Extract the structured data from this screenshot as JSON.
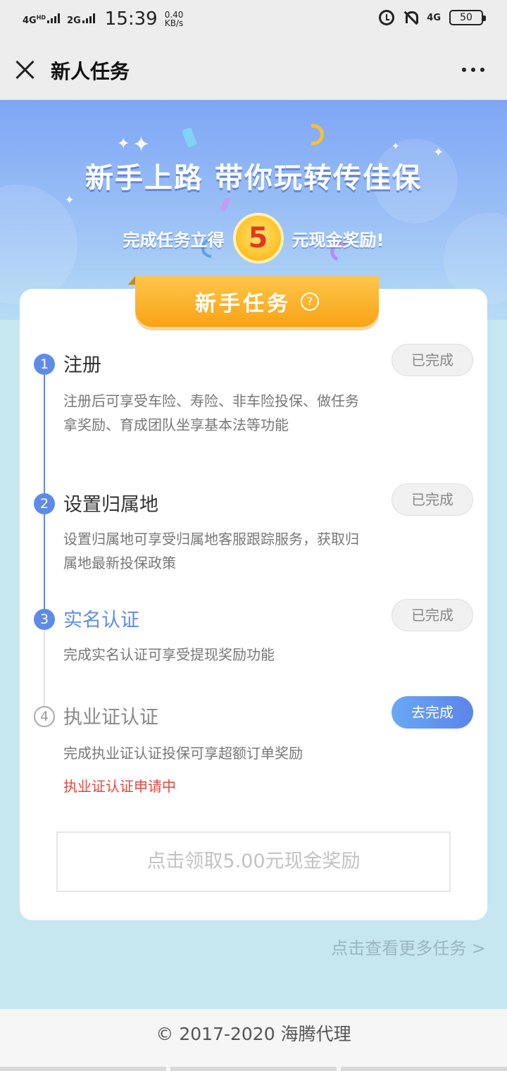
{
  "status_bar": {
    "network1": "4G",
    "network1_sup": "HD",
    "network2": "2G",
    "time": "15:39",
    "speed_value": "0.40",
    "speed_unit": "KB/s",
    "network3": "4G",
    "battery": "50"
  },
  "header": {
    "title": "新人任务"
  },
  "banner": {
    "title": "新手上路  带你玩转传佳保",
    "sub_prefix": "完成任务立得",
    "coin_value": "5",
    "sub_suffix": "元现金奖励!"
  },
  "card": {
    "tab_label": "新手任务",
    "help_symbol": "?",
    "tasks": [
      {
        "step": "1",
        "title": "注册",
        "desc": "注册后可享受车险、寿险、非车险投保、做任务拿奖励、育成团队坐享基本法等功能",
        "button": "已完成"
      },
      {
        "step": "2",
        "title": "设置归属地",
        "desc": "设置归属地可享受归属地客服跟踪服务，获取归属地最新投保政策",
        "button": "已完成"
      },
      {
        "step": "3",
        "title": "实名认证",
        "desc": "完成实名认证可享受提现奖励功能",
        "button": "已完成"
      },
      {
        "step": "4",
        "title": "执业证认证",
        "desc": "完成执业证认证投保可享超额订单奖励",
        "status": "执业证认证申请中",
        "button": "去完成"
      }
    ],
    "claim_button": "点击领取5.00元现金奖励"
  },
  "more_tasks_link": "点击查看更多任务 >",
  "footer": "© 2017-2020 海腾代理",
  "colors": {
    "accent_blue": "#5e8be8",
    "tab_orange": "#f8a316",
    "warning_red": "#e5463f",
    "page_bg": "#c6e7f0"
  }
}
